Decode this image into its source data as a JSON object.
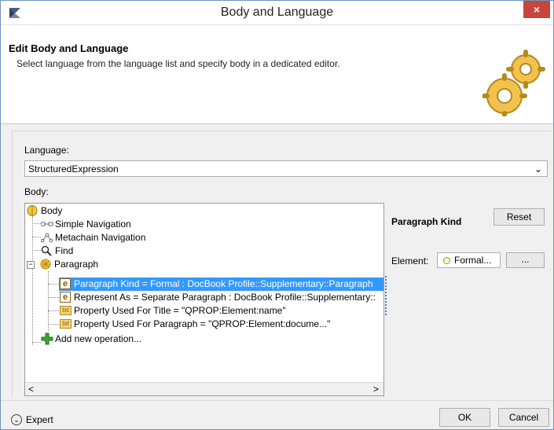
{
  "window": {
    "title": "Body and Language",
    "close_glyph": "×"
  },
  "header": {
    "title": "Edit Body and Language",
    "description": "Select language from the language list and specify body in a dedicated editor."
  },
  "language": {
    "label": "Language:",
    "value": "StructuredExpression"
  },
  "body": {
    "label": "Body:",
    "tree": [
      {
        "label": "Body",
        "icon": "body-icon"
      },
      {
        "label": "Simple Navigation",
        "icon": "simple-navigation-icon"
      },
      {
        "label": "Metachain Navigation",
        "icon": "metachain-navigation-icon"
      },
      {
        "label": "Find",
        "icon": "magnifier-icon"
      },
      {
        "label": "Paragraph",
        "icon": "paragraph-operation-icon",
        "expander": "−"
      },
      {
        "label": "Paragraph Kind = Formal : DocBook Profile::Supplementary::Paragraph",
        "icon": "enumeration-icon",
        "selected": true
      },
      {
        "label": "Represent As = Separate Paragraph : DocBook Profile::Supplementary::",
        "icon": "enumeration-icon"
      },
      {
        "label": "Property Used For Title = \"QPROP:Element:name\"",
        "icon": "text-icon"
      },
      {
        "label": "Property Used For Paragraph = \"QPROP:Element:docume...\"",
        "icon": "text-icon"
      },
      {
        "label": "Add new operation...",
        "icon": "add-plus-icon"
      }
    ],
    "scroll_left": "<",
    "scroll_right": ">",
    "icon_glyphs": {
      "enum": "e",
      "text": "txt"
    }
  },
  "properties": {
    "title": "Paragraph Kind",
    "reset_label": "Reset",
    "element_label": "Element:",
    "element_value": "Formal...",
    "browse_label": "..."
  },
  "footer": {
    "expert_label": "Expert",
    "expert_glyph": "⌄",
    "ok_label": "OK",
    "cancel_label": "Cancel"
  },
  "colors": {
    "selection": "#3399ff",
    "close": "#c8453c",
    "add": "#2e9b2e"
  }
}
